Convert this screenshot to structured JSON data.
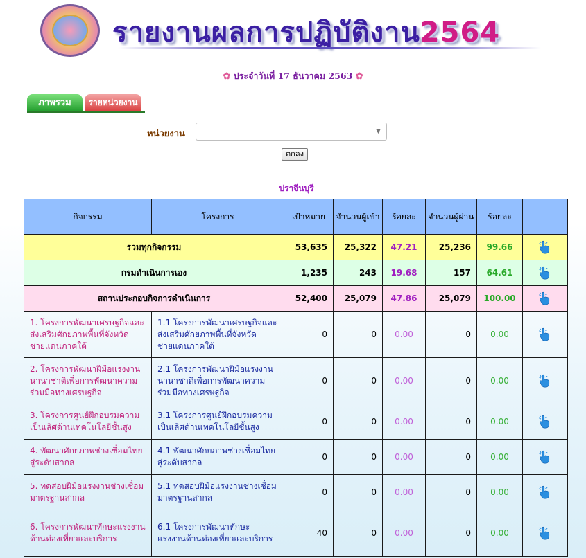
{
  "header": {
    "title_text": "รายงานผลการปฏิบัติงาน",
    "title_year": "2564",
    "date_line": "ประจำวันที่ 17 ธันวาคม 2563"
  },
  "tabs": [
    {
      "label": "ภาพรวม",
      "active": true
    },
    {
      "label": "รายหน่วยงาน",
      "active": false
    }
  ],
  "filter": {
    "label": "หน่วยงาน",
    "selected_value": "",
    "ok_label": "ตกลง"
  },
  "province": "ปราจีนบุรี",
  "table": {
    "headers": [
      "กิจกรรม",
      "โครงการ",
      "เป้าหมาย",
      "จำนวนผู้เข้า",
      "ร้อยละ",
      "จำนวนผู้ผ่าน",
      "ร้อยละ"
    ],
    "summary_rows": [
      {
        "label": "รวมทุกกิจกรรม",
        "target": "53,635",
        "entered": "25,322",
        "pct_entered": "47.21",
        "passed": "25,236",
        "pct_passed": "99.66"
      },
      {
        "label": "กรมดำเนินการเอง",
        "target": "1,235",
        "entered": "243",
        "pct_entered": "19.68",
        "passed": "157",
        "pct_passed": "64.61"
      },
      {
        "label": "สถานประกอบกิจการดำเนินการ",
        "target": "52,400",
        "entered": "25,079",
        "pct_entered": "47.86",
        "passed": "25,079",
        "pct_passed": "100.00"
      }
    ],
    "rows": [
      {
        "activity": "1. โครงการพัฒนาเศรษฐกิจและส่งเสริมศักยภาพพื้นที่จังหวัดชายแดนภาคใต้",
        "project": "1.1 โครงการพัฒนาเศรษฐกิจและส่งเสริมศักยภาพพื้นที่จังหวัดชายแดนภาคใต้",
        "target": "0",
        "entered": "0",
        "pct_entered": "0.00",
        "passed": "0",
        "pct_passed": "0.00"
      },
      {
        "activity": "2. โครงการพัฒนาฝีมือแรงงานนานาชาติเพื่อการพัฒนาความร่วมมือทางเศรษฐกิจ",
        "project": "2.1 โครงการพัฒนาฝีมือแรงงานนานาชาติเพื่อการพัฒนาความร่วมมือทางเศรษฐกิจ",
        "target": "0",
        "entered": "0",
        "pct_entered": "0.00",
        "passed": "0",
        "pct_passed": "0.00"
      },
      {
        "activity": "3. โครงการศูนย์ฝึกอบรมความเป็นเลิศด้านเทคโนโลยีชั้นสูง",
        "project": "3.1 โครงการศูนย์ฝึกอบรมความเป็นเลิศด้านเทคโนโลยีชั้นสูง",
        "target": "0",
        "entered": "0",
        "pct_entered": "0.00",
        "passed": "0",
        "pct_passed": "0.00"
      },
      {
        "activity": "4. พัฒนาศักยภาพช่างเชื่อมไทยสู่ระดับสากล",
        "project": "4.1 พัฒนาศักยภาพช่างเชื่อมไทยสู่ระดับสากล",
        "target": "0",
        "entered": "0",
        "pct_entered": "0.00",
        "passed": "0",
        "pct_passed": "0.00"
      },
      {
        "activity": "5. ทดสอบฝีมือแรงงานช่างเชื่อมมาตรฐานสากล",
        "project": "5.1 ทดสอบฝีมือแรงงานช่างเชื่อมมาตรฐานสากล",
        "target": "0",
        "entered": "0",
        "pct_entered": "0.00",
        "passed": "0",
        "pct_passed": "0.00"
      },
      {
        "activity": "6. โครงการพัฒนาทักษะแรงงานด้านท่องเที่ยวและบริการ",
        "project": "6.1 โครงการพัฒนาทักษะแรงงานด้านท่องเที่ยวและบริการ",
        "target": "40",
        "entered": "0",
        "pct_entered": "0.00",
        "passed": "0",
        "pct_passed": "0.00"
      }
    ]
  },
  "icons": {
    "detail": "pointing-hand-icon",
    "date_decoration": "flower-icon"
  },
  "colors": {
    "title": "#3b1fa3",
    "year": "#d01c86",
    "header_bg": "#93bfff",
    "row_total": "#ffff99",
    "row_dept": "#ddffe6",
    "row_business": "#ffdcee"
  }
}
